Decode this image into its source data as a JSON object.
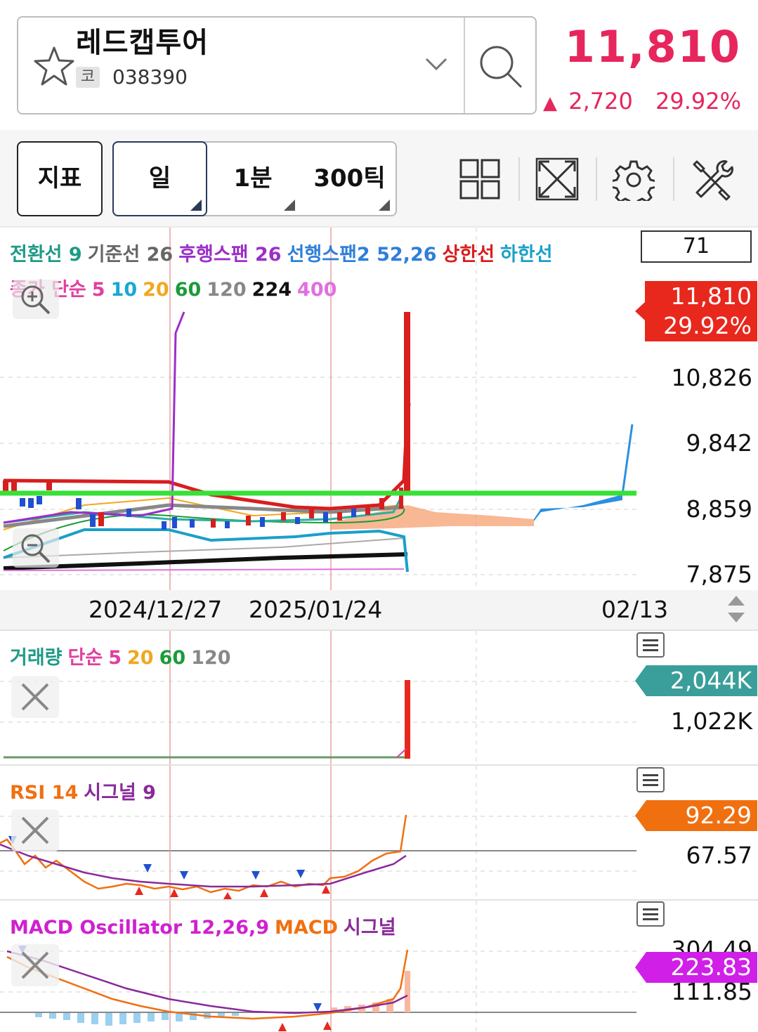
{
  "header": {
    "stock_name": "레드캡투어",
    "market_badge": "코",
    "stock_code": "038390",
    "price": "11,810",
    "change_arrow": "▲",
    "change_amount": "2,720",
    "change_percent": "29.92%",
    "up_color": "#e6265c"
  },
  "toolbar": {
    "indicator_button": "지표",
    "period_day": "일",
    "period_1min": "1분",
    "period_300tick": "300틱",
    "icons": [
      "grid-layout-icon",
      "expand-icon",
      "gear-icon",
      "tools-icon"
    ]
  },
  "main_chart": {
    "legend_line1": [
      {
        "text": "전환선 9",
        "color": "#1f9a86"
      },
      {
        "text": "기준선 26",
        "color": "#666666"
      },
      {
        "text": "후행스팬 26",
        "color": "#9b2fc8"
      },
      {
        "text": "선행스팬2 52,26",
        "color": "#2f7fd8"
      },
      {
        "text": "상한선",
        "color": "#d81e1e"
      },
      {
        "text": "하한선",
        "color": "#1aa0c8"
      }
    ],
    "legend_line2": [
      {
        "text": "종가 단순",
        "color": "#e040a0"
      },
      {
        "text": "5",
        "color": "#e040a0"
      },
      {
        "text": "10",
        "color": "#17a8d6"
      },
      {
        "text": "20",
        "color": "#f0a820"
      },
      {
        "text": "60",
        "color": "#1c9a3a"
      },
      {
        "text": "120",
        "color": "#888888"
      },
      {
        "text": "224",
        "color": "#111111"
      },
      {
        "text": "400",
        "color": "#e070e0"
      }
    ],
    "count_box": "71",
    "price_tag": {
      "price": "11,810",
      "percent": "29.92%",
      "color": "#e8281c"
    },
    "y_axis": [
      "10,826",
      "9,842",
      "8,859",
      "7,875"
    ],
    "x_axis": [
      "2024/12/27",
      "2025/01/24",
      "02/13"
    ]
  },
  "volume_panel": {
    "legend": [
      {
        "text": "거래량",
        "color": "#1f9a86"
      },
      {
        "text": "단순",
        "color": "#e040a0"
      },
      {
        "text": "5",
        "color": "#e040a0"
      },
      {
        "text": "20",
        "color": "#f0a820"
      },
      {
        "text": "60",
        "color": "#1c9a3a"
      },
      {
        "text": "120",
        "color": "#888888"
      }
    ],
    "tag": {
      "value": "2,044K",
      "color": "#3a9e9a"
    },
    "y_axis": [
      "1,022K"
    ]
  },
  "rsi_panel": {
    "legend": [
      {
        "text": "RSI 14",
        "color": "#f07010"
      },
      {
        "text": "시그널 9",
        "color": "#8a2a9a"
      }
    ],
    "tag": {
      "value": "92.29",
      "color": "#f07010"
    },
    "y_axis": [
      "67.57"
    ]
  },
  "macd_panel": {
    "legend": [
      {
        "text": "MACD Oscillator 12,26,9",
        "color": "#d020d0"
      },
      {
        "text": "MACD",
        "color": "#f07010"
      },
      {
        "text": "시그널",
        "color": "#8a2a9a"
      }
    ],
    "tag": {
      "value": "223.83",
      "color": "#d020e8"
    },
    "y_axis": [
      "304.49",
      "111.85"
    ]
  }
}
